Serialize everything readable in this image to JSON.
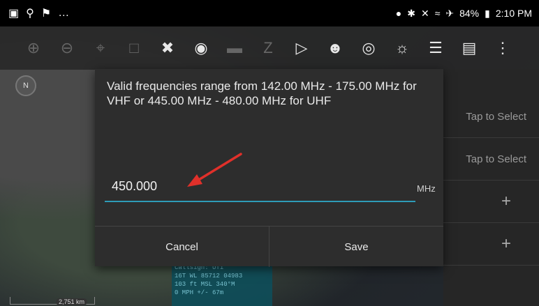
{
  "status_bar": {
    "left_icons": [
      "image-icon",
      "signal-person-icon",
      "flag-icon",
      "more-icon"
    ],
    "battery": "84%",
    "time": "2:10 PM"
  },
  "toolbar": {
    "icons": [
      "zoom-in-icon",
      "zoom-out-icon",
      "crosshair-icon",
      "lock-icon",
      "close-x-icon",
      "helmet-icon",
      "ruler-icon",
      "route-icon",
      "video-icon",
      "group-icon",
      "add-marker-icon",
      "globe-add-icon",
      "layers-icon",
      "map-icon",
      "overflow-menu-icon"
    ]
  },
  "compass": {
    "label": "N"
  },
  "right_panel": {
    "row1": "Tap to Select",
    "row2": "Tap to Select",
    "row3": "+",
    "row4": "+"
  },
  "dialog": {
    "message": "Valid frequencies range from 142.00 MHz - 175.00 MHz for VHF or 445.00 MHz - 480.00 MHz for UHF",
    "input_value": "450.000",
    "unit": "MHz",
    "cancel_label": "Cancel",
    "save_label": "Save",
    "accent_color": "#2e9bb8",
    "annotation_color": "#e0302a"
  },
  "info_overlay": {
    "line1": "Callsign: UT1",
    "line2": "16T  WL  85712  04983",
    "line3": "103 ft MSL       340°M",
    "line4": "0 MPH         +/- 67m"
  },
  "scale": {
    "label": "2,751 km"
  }
}
